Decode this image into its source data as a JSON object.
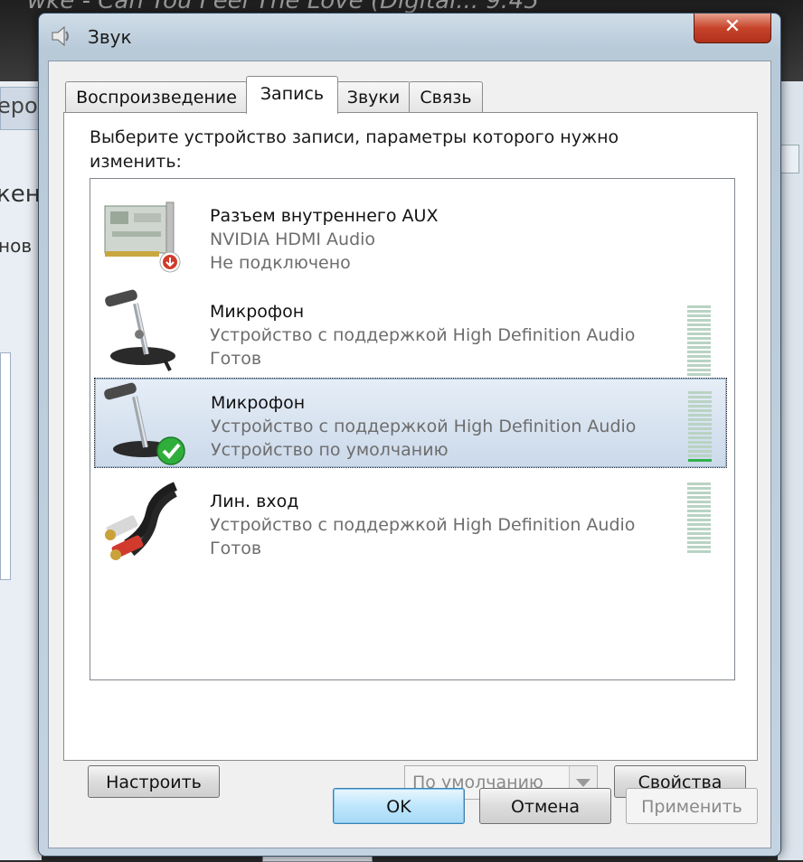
{
  "background": {
    "media_title": "wke - Can You Feel The Love (Digital... 9:45",
    "left_strip_text": "еро",
    "left_text_1": "кен",
    "left_text_2": "нов"
  },
  "window": {
    "title": "Звук",
    "close_label": "✕"
  },
  "tabs": [
    {
      "label": "Воспроизведение",
      "active": false
    },
    {
      "label": "Запись",
      "active": true
    },
    {
      "label": "Звуки",
      "active": false
    },
    {
      "label": "Связь",
      "active": false
    }
  ],
  "instruction": "Выберите устройство записи, параметры которого нужно изменить:",
  "devices": [
    {
      "name": "Разъем внутреннего  AUX",
      "description": "NVIDIA HDMI Audio",
      "status": "Не подключено",
      "icon": "sound-card-icon",
      "level": 0,
      "selected": false
    },
    {
      "name": "Микрофон",
      "description": "Устройство с поддержкой High Definition Audio",
      "status": "Готов",
      "icon": "microphone-icon",
      "level": 0,
      "selected": false
    },
    {
      "name": "Микрофон",
      "description": "Устройство с поддержкой High Definition Audio",
      "status": "Устройство по умолчанию",
      "icon": "microphone-default-icon",
      "level": 0.07,
      "selected": true
    },
    {
      "name": "Лин. вход",
      "description": "Устройство с поддержкой High Definition Audio",
      "status": "Готов",
      "icon": "rca-cable-icon",
      "level": 0,
      "selected": false
    }
  ],
  "buttons": {
    "configure": "Настроить",
    "set_default": "По умолчанию",
    "properties": "Свойства",
    "ok": "OK",
    "cancel": "Отмена",
    "apply": "Применить"
  }
}
